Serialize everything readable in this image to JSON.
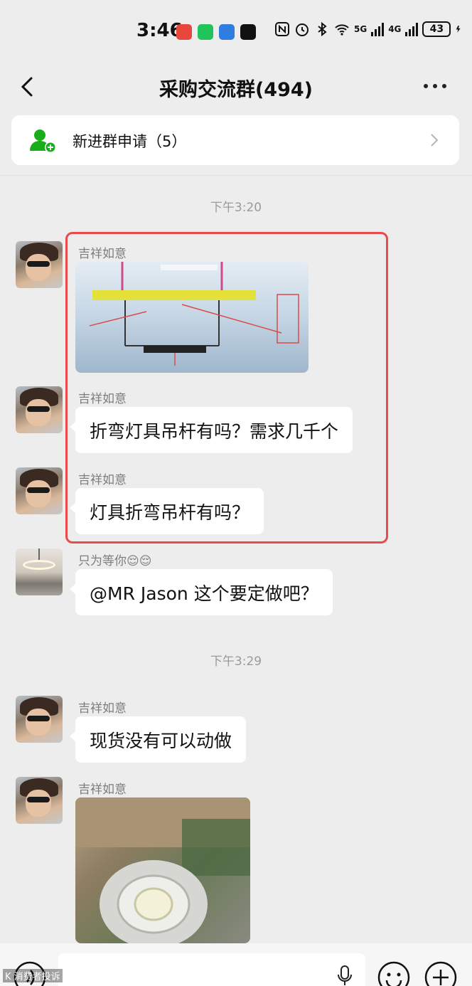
{
  "status_bar": {
    "time": "3:46",
    "network_5g": "5G",
    "network_4g": "4G",
    "battery": "43"
  },
  "nav": {
    "title": "采购交流群(494)"
  },
  "join_request": {
    "label": "新进群申请（5）"
  },
  "timestamps": [
    "下午3:20",
    "下午3:29"
  ],
  "messages": [
    {
      "sender": "吉祥如意",
      "type": "image",
      "image_desc": "lamp-rod-diagram-image"
    },
    {
      "sender": "吉祥如意",
      "type": "text",
      "text": "折弯灯具吊杆有吗？需求几千个"
    },
    {
      "sender": "吉祥如意",
      "type": "text",
      "text": "灯具折弯吊杆有吗？"
    },
    {
      "sender": "只为等你😌😌",
      "type": "text",
      "text": "@MR Jason  这个要定做吧？"
    },
    {
      "sender": "吉祥如意",
      "type": "text",
      "text": "现货没有可以动做"
    },
    {
      "sender": "吉祥如意",
      "type": "image",
      "image_desc": "downlight-photo-image"
    }
  ],
  "input_bar": {
    "placeholder": ""
  },
  "watermark": "K 消费者投诉",
  "colors": {
    "background": "#ededed",
    "bubble": "#ffffff",
    "highlight": "#e94b4b",
    "join_icon": "#1aad19"
  }
}
